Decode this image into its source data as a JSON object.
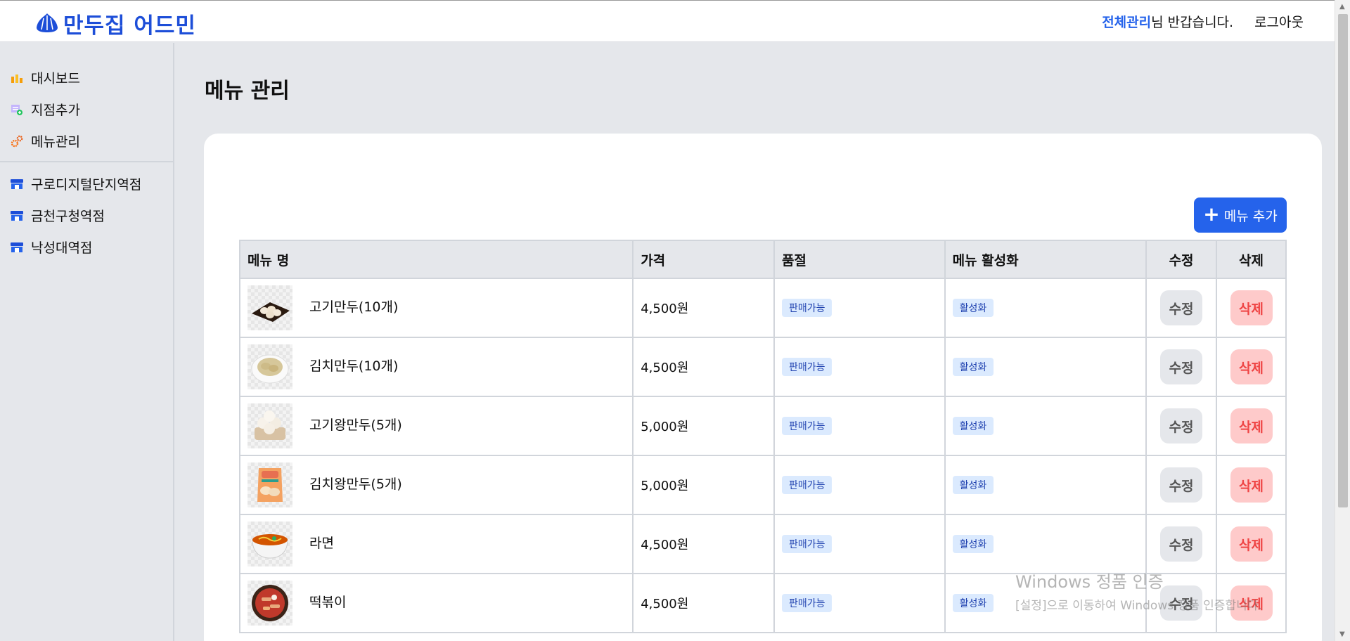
{
  "header": {
    "logo_text": "만두집 어드민",
    "user_name": "전체관리",
    "greeting": "님 반갑습니다.",
    "logout": "로그아웃"
  },
  "sidebar": {
    "main_items": [
      {
        "label": "대시보드",
        "icon": "chart-bar-icon"
      },
      {
        "label": "지점추가",
        "icon": "add-store-icon"
      },
      {
        "label": "메뉴관리",
        "icon": "gears-icon"
      }
    ],
    "stores": [
      {
        "label": "구로디지털단지역점",
        "icon": "store-icon"
      },
      {
        "label": "금천구청역점",
        "icon": "store-icon"
      },
      {
        "label": "낙성대역점",
        "icon": "store-icon"
      }
    ]
  },
  "main": {
    "title": "메뉴 관리",
    "add_button": "메뉴 추가",
    "table": {
      "headers": [
        "메뉴 명",
        "가격",
        "품절",
        "메뉴 활성화",
        "수정",
        "삭제"
      ],
      "rows": [
        {
          "name": "고기만두(10개)",
          "price": "4,500원",
          "soldout": "판매가능",
          "active": "활성화",
          "edit": "수정",
          "delete": "삭제",
          "image": "dumpling-plate"
        },
        {
          "name": "김치만두(10개)",
          "price": "4,500원",
          "soldout": "판매가능",
          "active": "활성화",
          "edit": "수정",
          "delete": "삭제",
          "image": "dumpling-bowl"
        },
        {
          "name": "고기왕만두(5개)",
          "price": "5,000원",
          "soldout": "판매가능",
          "active": "활성화",
          "edit": "수정",
          "delete": "삭제",
          "image": "steamer-buns"
        },
        {
          "name": "김치왕만두(5개)",
          "price": "5,000원",
          "soldout": "판매가능",
          "active": "활성화",
          "edit": "수정",
          "delete": "삭제",
          "image": "dumpling-package"
        },
        {
          "name": "라면",
          "price": "4,500원",
          "soldout": "판매가능",
          "active": "활성화",
          "edit": "수정",
          "delete": "삭제",
          "image": "ramen-bowl"
        },
        {
          "name": "떡볶이",
          "price": "4,500원",
          "soldout": "판매가능",
          "active": "활성화",
          "edit": "수정",
          "delete": "삭제",
          "image": "tteokbokki-pan"
        }
      ]
    }
  },
  "watermark": {
    "title": "Windows 정품 인증",
    "subtitle": "[설정]으로 이동하여 Windows 정품 인증합니다."
  },
  "colors": {
    "accent": "#2563eb",
    "background": "#e5e7eb",
    "delete": "#ef4444"
  }
}
